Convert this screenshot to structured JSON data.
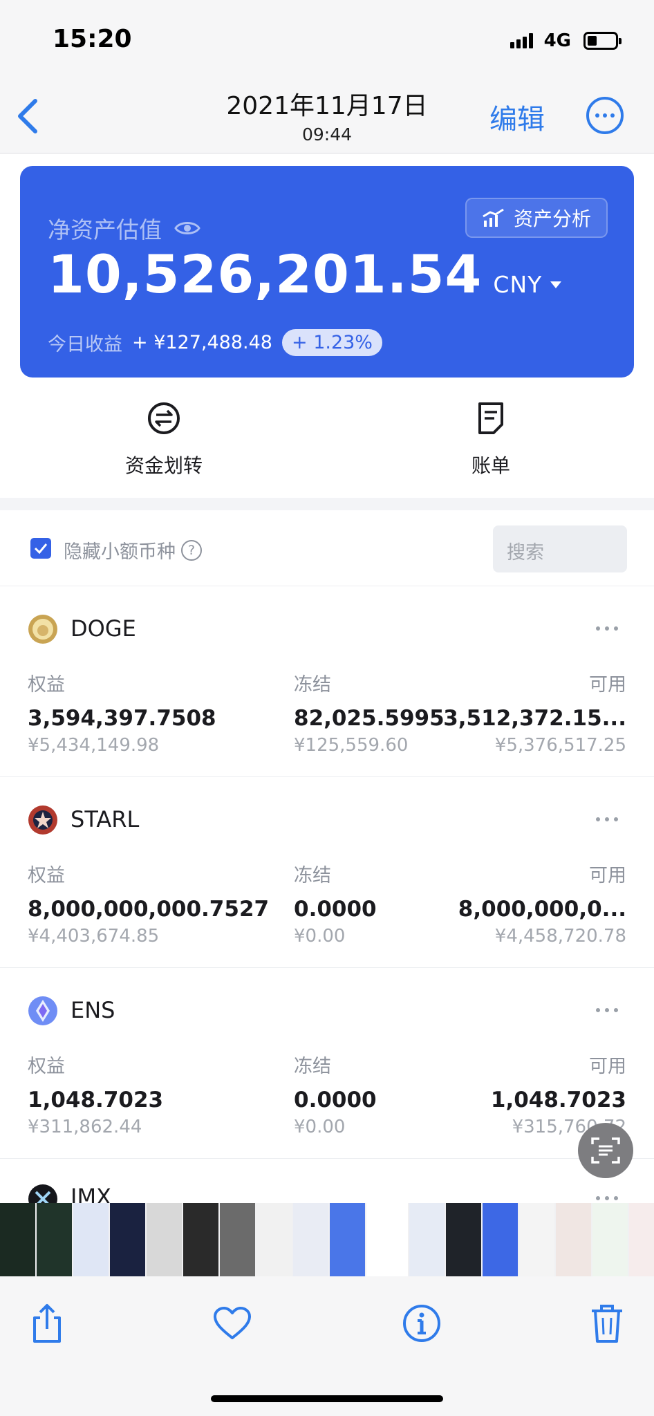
{
  "status_bar": {
    "time": "15:20",
    "network": "4G"
  },
  "photo_header": {
    "date": "2021年11月17日",
    "time": "09:44",
    "edit_label": "编辑"
  },
  "asset_card": {
    "net_label": "净资产估值",
    "analysis_label": "资产分析",
    "net_value": "10,526,201.54",
    "currency": "CNY",
    "today_label": "今日收益",
    "today_value": "+ ¥127,488.48",
    "today_pct": "+ 1.23%",
    "color": "#3461e6"
  },
  "quick_actions": [
    {
      "label": "资金划转",
      "icon": "transfer-icon"
    },
    {
      "label": "账单",
      "icon": "bill-icon"
    }
  ],
  "filter": {
    "hide_small_label": "隐藏小额币种",
    "hide_small_checked": true,
    "search_placeholder": "搜索"
  },
  "columns": {
    "equity": "权益",
    "frozen": "冻结",
    "available": "可用"
  },
  "coins": [
    {
      "name": "DOGE",
      "equity": "3,594,397.7508",
      "equity_cny": "¥5,434,149.98",
      "frozen": "82,025.5995",
      "frozen_cny": "¥125,559.60",
      "available": "3,512,372.15...",
      "available_cny": "¥5,376,517.25"
    },
    {
      "name": "STARL",
      "equity": "8,000,000,000.7527",
      "equity_cny": "¥4,403,674.85",
      "frozen": "0.0000",
      "frozen_cny": "¥0.00",
      "available": "8,000,000,0...",
      "available_cny": "¥4,458,720.78"
    },
    {
      "name": "ENS",
      "equity": "1,048.7023",
      "equity_cny": "¥311,862.44",
      "frozen": "0.0000",
      "frozen_cny": "¥0.00",
      "available": "1,048.7023",
      "available_cny": "¥315,760.72"
    },
    {
      "name": "IMX"
    }
  ],
  "toolbar": {
    "icons": [
      "share-icon",
      "heart-icon",
      "info-icon",
      "trash-icon"
    ],
    "accent": "#2f7bea"
  }
}
